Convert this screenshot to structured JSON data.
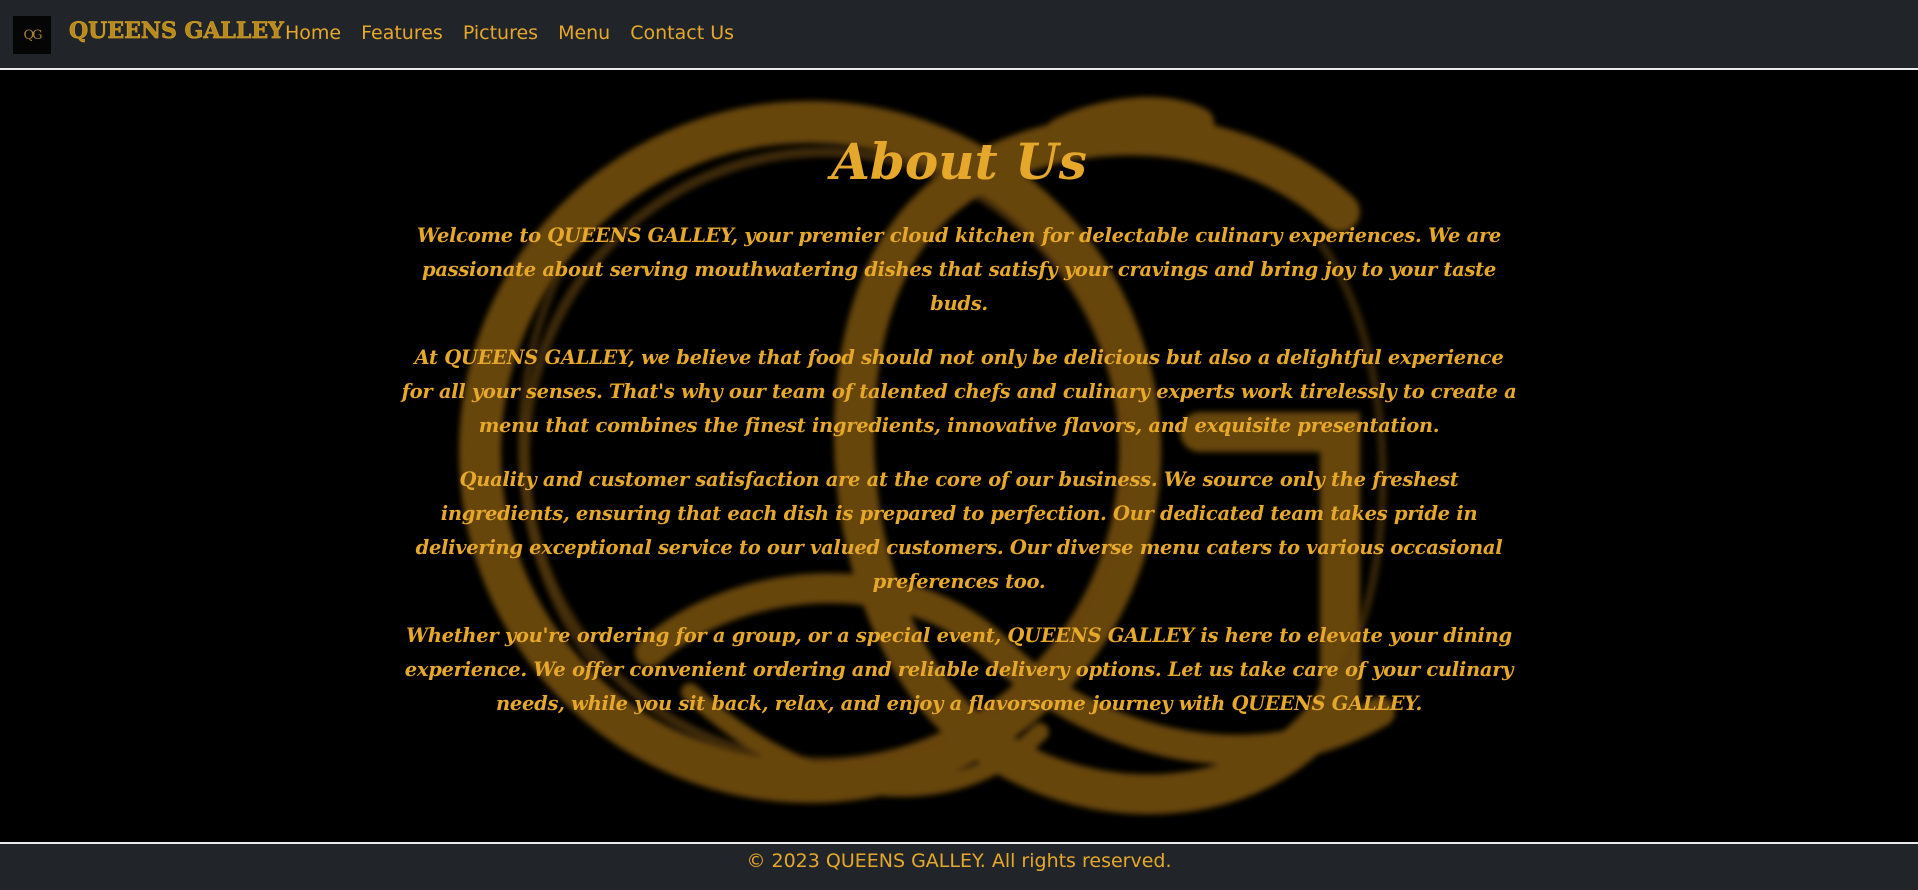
{
  "nav": {
    "logo_text": "QG",
    "brand": "QUEENS GALLEY",
    "links": [
      "Home",
      "Features",
      "Pictures",
      "Menu",
      "Contact Us"
    ]
  },
  "about": {
    "title": "About Us",
    "paragraphs": [
      "Welcome to QUEENS GALLEY, your premier cloud kitchen for delectable culinary experiences. We are passionate about serving mouthwatering dishes that satisfy your cravings and bring joy to your taste buds.",
      "At QUEENS GALLEY, we believe that food should not only be delicious but also a delightful experience for all your senses. That's why our team of talented chefs and culinary experts work tirelessly to create a menu that combines the finest ingredients, innovative flavors, and exquisite presentation.",
      "Quality and customer satisfaction are at the core of our business. We source only the freshest ingredients, ensuring that each dish is prepared to perfection. Our dedicated team takes pride in delivering exceptional service to our valued customers. Our diverse menu caters to various occasional preferences too.",
      "Whether you're ordering for a group, or a special event, QUEENS GALLEY is here to elevate your dining experience. We offer convenient ordering and reliable delivery options. Let us take care of your culinary needs, while you sit back, relax, and enjoy a flavorsome journey with QUEENS GALLEY."
    ]
  },
  "footer": {
    "copyright": "© 2023 QUEENS GALLEY. All rights reserved."
  },
  "colors": {
    "accent": "#e6a82a",
    "navbar_bg": "#212529",
    "page_bg": "#000000",
    "watermark": "#8a5e10"
  }
}
